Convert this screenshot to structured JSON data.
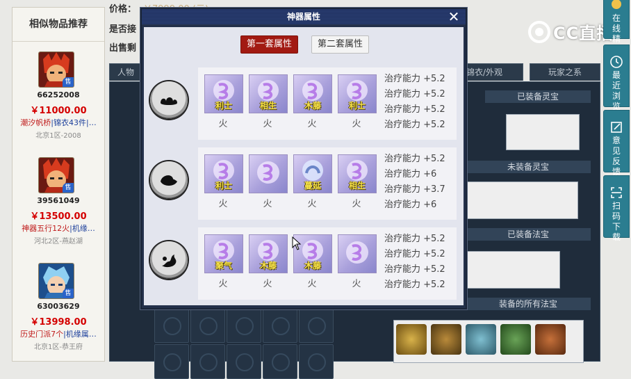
{
  "page": {
    "price_label": "价格：",
    "price_value": "￥7999.00 (元)",
    "line2": "是否接",
    "line3": "出售剩"
  },
  "recommend": {
    "title": "相似物品推荐",
    "items": [
      {
        "id": "66252008",
        "price": "￥11000.00",
        "desc_red": "潮汐帆桥",
        "desc_blue": "|锦衣43件|…",
        "server": "北京1区-2008",
        "tag": "售"
      },
      {
        "id": "39561049",
        "price": "￥13500.00",
        "desc_red": "神器五行12火",
        "desc_blue": "|机缘…",
        "server": "河北2区-燕赵湖",
        "tag": "售"
      },
      {
        "id": "63003629",
        "price": "￥13998.00",
        "desc_red": "历史门派7个",
        "desc_blue": "|机缘属…",
        "server": "北京1区-恭王府",
        "tag": "售"
      }
    ]
  },
  "background": {
    "tabs": [
      "人物",
      "锦衣/外观",
      "玩家之系"
    ],
    "section_equipped_spirit": "已装备灵宝",
    "section_unequipped_spirit": "未装备灵宝",
    "section_equipped_magic": "已装备法宝",
    "section_all_magic": "装备的所有法宝"
  },
  "sidebar": {
    "buttons": [
      {
        "label": "在线精灵",
        "icon": "chat-icon"
      },
      {
        "label": "最近浏览",
        "icon": "clock-icon"
      },
      {
        "label": "意见反馈",
        "icon": "edit-icon"
      },
      {
        "label": "扫码下载",
        "icon": "scan-icon"
      }
    ]
  },
  "logo": {
    "text": "CC直播"
  },
  "modal": {
    "title": "神器属性",
    "close": "✕",
    "tabs": {
      "active": "第一套属性",
      "inactive": "第二套属性"
    },
    "sets": [
      {
        "badge": "cloud-swirl-icon",
        "gems": [
          {
            "name": "利士",
            "element": "火"
          },
          {
            "name": "相生",
            "element": "火"
          },
          {
            "name": "木藤",
            "element": "火"
          },
          {
            "name": "利士",
            "element": "火"
          }
        ],
        "attrs": [
          "治疗能力 +5.2",
          "治疗能力 +5.2",
          "治疗能力 +5.2",
          "治疗能力 +5.2"
        ]
      },
      {
        "badge": "wave-swirl-icon",
        "gems": [
          {
            "name": "利士",
            "element": "火"
          },
          {
            "name": "",
            "element": "火"
          },
          {
            "name": "蔓延",
            "element": "火"
          },
          {
            "name": "相生",
            "element": "火"
          }
        ],
        "attrs": [
          "治疗能力 +5.2",
          "治疗能力 +6",
          "治疗能力 +3.7",
          "治疗能力 +6"
        ]
      },
      {
        "badge": "flame-swirl-icon",
        "gems": [
          {
            "name": "聚气",
            "element": "火"
          },
          {
            "name": "木藤",
            "element": "火"
          },
          {
            "name": "木藤",
            "element": "火"
          },
          {
            "name": "",
            "element": "火"
          }
        ],
        "attrs": [
          "治疗能力 +5.2",
          "治疗能力 +5.2",
          "治疗能力 +5.2",
          "治疗能力 +5.2"
        ]
      }
    ]
  }
}
